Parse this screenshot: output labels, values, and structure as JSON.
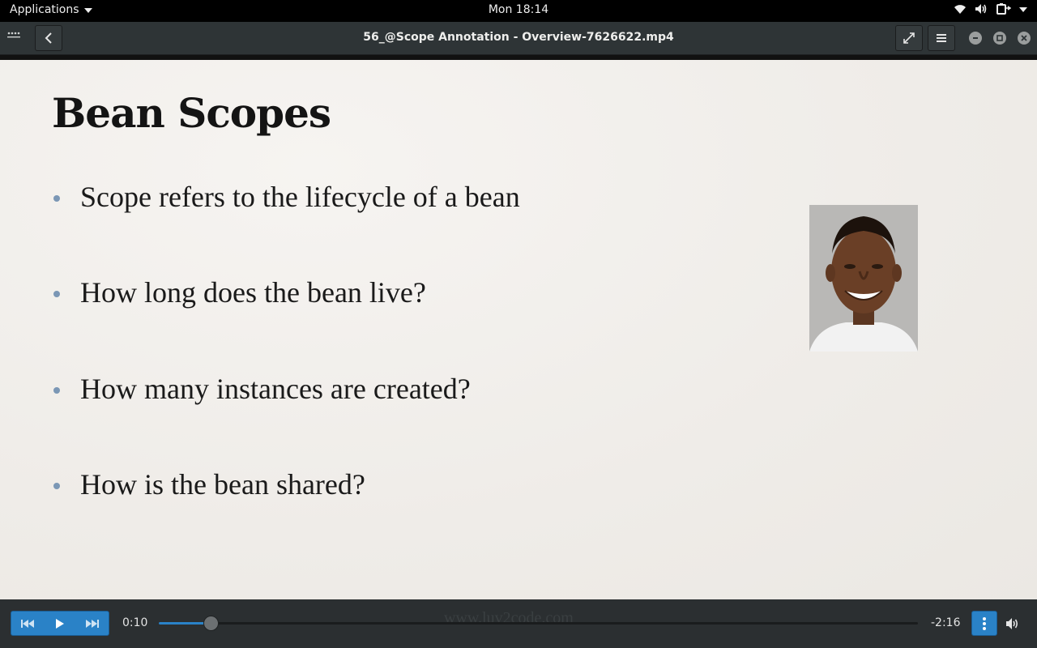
{
  "topbar": {
    "applications_label": "Applications",
    "clock": "Mon 18:14",
    "tray_icons": [
      "wifi-icon",
      "volume-icon",
      "battery-icon",
      "chevron-down-icon"
    ]
  },
  "header": {
    "title": "56_@Scope Annotation - Overview-7626622.mp4"
  },
  "slide": {
    "title": "Bean Scopes",
    "bullets": [
      "Scope refers to the lifecycle of a bean",
      "How long does the bean live?",
      "How many instances are created?",
      "How is the bean shared?"
    ]
  },
  "controls": {
    "elapsed": "0:10",
    "remaining": "-2:16",
    "progress_fraction": 0.068,
    "watermark": "www.luv2code.com"
  },
  "colors": {
    "accent": "#2a82c7",
    "headerbar": "#2e3436",
    "slide_bg": "#f1efeb",
    "bullet_dot": "#7b97b5"
  }
}
